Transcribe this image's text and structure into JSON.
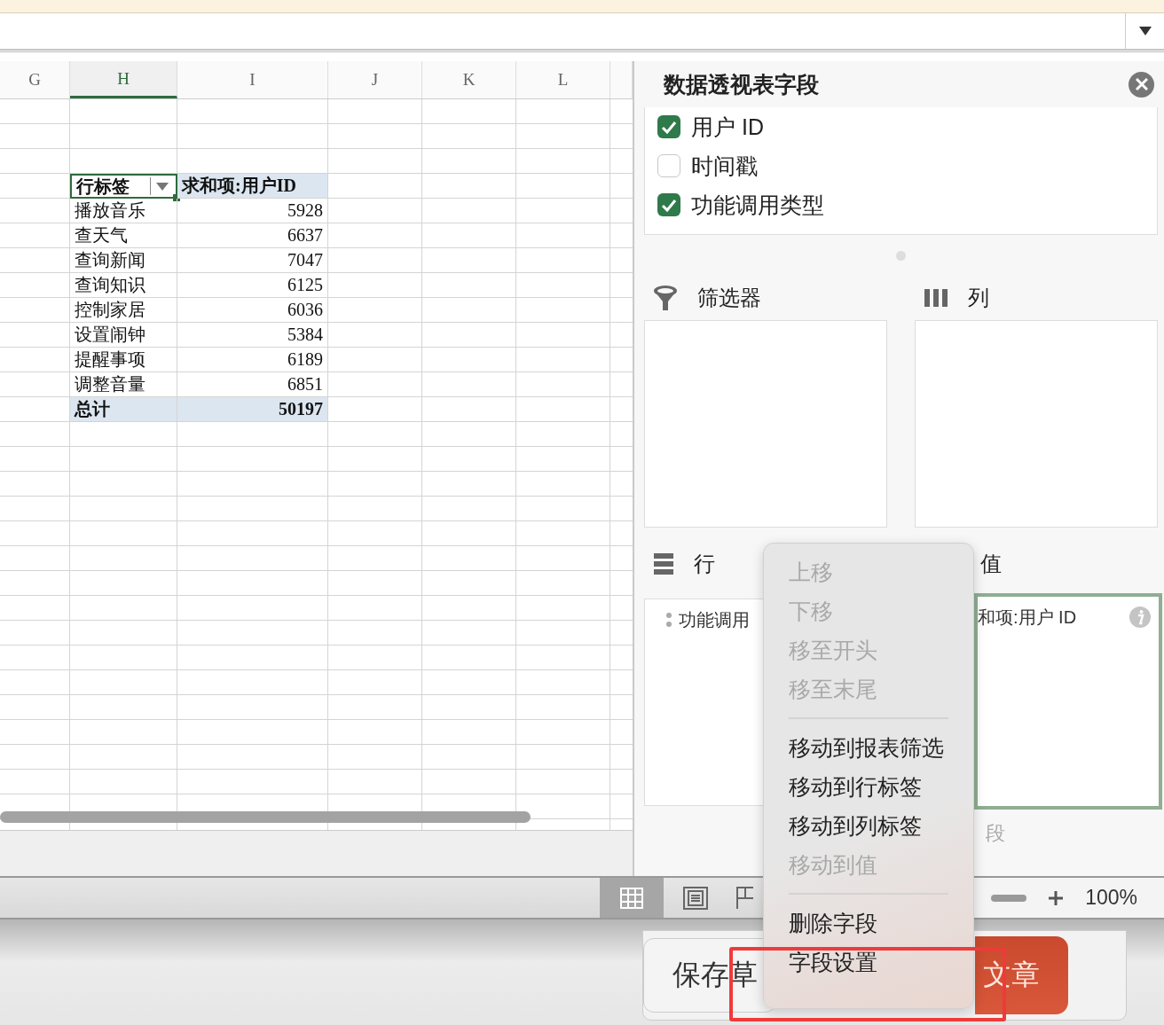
{
  "sheet": {
    "columns": [
      {
        "label": "G",
        "selected": false
      },
      {
        "label": "H",
        "selected": true
      },
      {
        "label": "I",
        "selected": false
      },
      {
        "label": "J",
        "selected": false
      },
      {
        "label": "K",
        "selected": false
      },
      {
        "label": "L",
        "selected": false
      }
    ],
    "pivot": {
      "header_label": "行标签",
      "header_value": "求和项:用户ID",
      "rows": [
        {
          "label": "播放音乐",
          "value": "5928"
        },
        {
          "label": "查天气",
          "value": "6637"
        },
        {
          "label": "查询新闻",
          "value": "7047"
        },
        {
          "label": "查询知识",
          "value": "6125"
        },
        {
          "label": "控制家居",
          "value": "6036"
        },
        {
          "label": "设置闹钟",
          "value": "5384"
        },
        {
          "label": "提醒事项",
          "value": "6189"
        },
        {
          "label": "调整音量",
          "value": "6851"
        }
      ],
      "total": {
        "label": "总计",
        "value": "50197"
      }
    }
  },
  "panel": {
    "title": "数据透视表字段",
    "fields": [
      {
        "label": "用户 ID",
        "checked": true
      },
      {
        "label": "时间戳",
        "checked": false
      },
      {
        "label": "功能调用类型",
        "checked": true
      }
    ],
    "filters": {
      "label": "筛选器"
    },
    "columns": {
      "label": "列"
    },
    "rows": {
      "label": "行",
      "items": [
        "功能调用"
      ]
    },
    "values": {
      "label": "值",
      "items": [
        "和项:用户 ID"
      ]
    },
    "hint": "段"
  },
  "status_bar": {
    "views": [
      {
        "selected": true
      },
      {
        "selected": false
      },
      {
        "selected": false
      }
    ],
    "zoom": "100%"
  },
  "footer": {
    "save_label": "保存草",
    "publish_label": "文章"
  },
  "context_menu": {
    "groups": [
      [
        {
          "label": "上移",
          "disabled": true
        },
        {
          "label": "下移",
          "disabled": true
        },
        {
          "label": "移至开头",
          "disabled": true
        },
        {
          "label": "移至末尾",
          "disabled": true
        }
      ],
      [
        {
          "label": "移动到报表筛选",
          "disabled": false
        },
        {
          "label": "移动到行标签",
          "disabled": false
        },
        {
          "label": "移动到列标签",
          "disabled": false
        },
        {
          "label": "移动到值",
          "disabled": true
        }
      ],
      [
        {
          "label": "删除字段",
          "disabled": false
        },
        {
          "label": "字段设置",
          "disabled": false
        }
      ]
    ]
  }
}
